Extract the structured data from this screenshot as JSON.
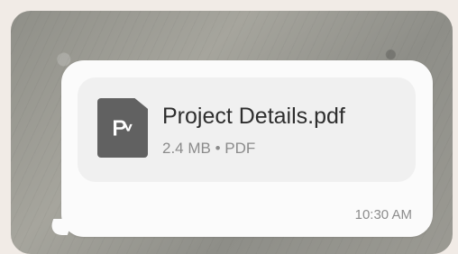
{
  "message": {
    "attachment": {
      "name": "Project Details.pdf",
      "size": "2.4 MB",
      "separator": " • ",
      "type": "PDF",
      "icon": "pdf-file-icon"
    },
    "timestamp": "10:30 AM"
  },
  "colors": {
    "bubble": "#fbfbfb",
    "card": "#f0f0f0",
    "icon": "#616161",
    "primary_text": "#2e2e2e",
    "secondary_text": "#8b8b8b"
  }
}
